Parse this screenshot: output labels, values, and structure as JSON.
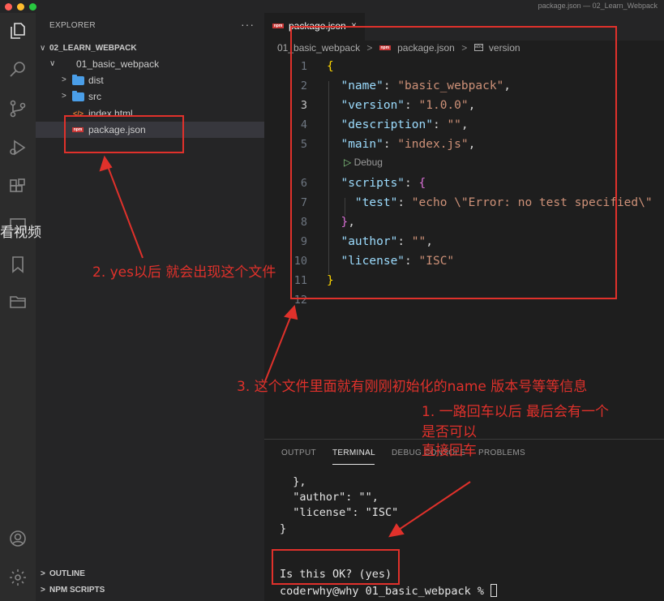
{
  "window": {
    "title": "package.json — 02_Learn_Webpack"
  },
  "activity_bar": {
    "icons": [
      "explorer-icon",
      "search-icon",
      "source-control-icon",
      "run-debug-icon",
      "extensions-icon",
      "remote-icon",
      "bookmark-icon",
      "folder-icon",
      "account-icon",
      "settings-gear-icon"
    ]
  },
  "watermark": "看视频",
  "sidebar": {
    "header": "EXPLORER",
    "more": "···",
    "workspace": "02_LEARN_WEBPACK",
    "tree": [
      {
        "label": "01_basic_webpack",
        "type": "folder",
        "open": true
      },
      {
        "label": "dist",
        "type": "folder",
        "open": false
      },
      {
        "label": "src",
        "type": "folder",
        "open": false
      },
      {
        "label": "index.html",
        "type": "html"
      },
      {
        "label": "package.json",
        "type": "npm",
        "selected": true
      }
    ],
    "sections": [
      "OUTLINE",
      "NPM SCRIPTS"
    ]
  },
  "editor": {
    "tab": {
      "label": "package.json",
      "close": "×",
      "icon_text": "npm"
    },
    "breadcrumb": [
      "01_basic_webpack",
      "package.json",
      "version"
    ],
    "debug_lens": "Debug",
    "lines": [
      {
        "n": "1",
        "tokens": [
          [
            "b1",
            "{"
          ]
        ]
      },
      {
        "n": "2",
        "tokens": [
          [
            "k",
            "\"name\""
          ],
          [
            "p",
            ": "
          ],
          [
            "s",
            "\"basic_webpack\""
          ],
          [
            "p",
            ","
          ]
        ]
      },
      {
        "n": "3",
        "tokens": [
          [
            "k",
            "\"version\""
          ],
          [
            "p",
            ": "
          ],
          [
            "s",
            "\"1.0.0\""
          ],
          [
            "p",
            ","
          ]
        ]
      },
      {
        "n": "4",
        "tokens": [
          [
            "k",
            "\"description\""
          ],
          [
            "p",
            ": "
          ],
          [
            "s",
            "\"\""
          ],
          [
            "p",
            ","
          ]
        ]
      },
      {
        "n": "5",
        "tokens": [
          [
            "k",
            "\"main\""
          ],
          [
            "p",
            ": "
          ],
          [
            "s",
            "\"index.js\""
          ],
          [
            "p",
            ","
          ]
        ]
      },
      {
        "n": "6",
        "tokens": [
          [
            "k",
            "\"scripts\""
          ],
          [
            "p",
            ": "
          ],
          [
            "b2",
            "{"
          ]
        ]
      },
      {
        "n": "7",
        "tokens": [
          [
            "k",
            "\"test\""
          ],
          [
            "p",
            ": "
          ],
          [
            "s",
            "\"echo \\\"Error: no test specified\\\""
          ]
        ]
      },
      {
        "n": "8",
        "tokens": [
          [
            "b2",
            "}"
          ],
          [
            "p",
            ","
          ]
        ]
      },
      {
        "n": "9",
        "tokens": [
          [
            "k",
            "\"author\""
          ],
          [
            "p",
            ": "
          ],
          [
            "s",
            "\"\""
          ],
          [
            "p",
            ","
          ]
        ]
      },
      {
        "n": "10",
        "tokens": [
          [
            "k",
            "\"license\""
          ],
          [
            "p",
            ": "
          ],
          [
            "s",
            "\"ISC\""
          ]
        ]
      },
      {
        "n": "11",
        "tokens": [
          [
            "b1",
            "}"
          ]
        ]
      },
      {
        "n": "12",
        "tokens": []
      }
    ],
    "current_line": "3"
  },
  "panel": {
    "tabs": [
      "OUTPUT",
      "TERMINAL",
      "DEBUG CONSOLE",
      "PROBLEMS"
    ],
    "active_tab": "TERMINAL",
    "terminal_lines": [
      "  },",
      "  \"author\": \"\",",
      "  \"license\": \"ISC\"",
      "}",
      "",
      "Is this OK? (yes)",
      "coderwhy@why 01_basic_webpack % "
    ]
  },
  "annotations": {
    "note2": "2. yes以后 就会出现这个文件",
    "note3": "3. 这个文件里面就有刚刚初始化的name 版本号等等信息",
    "note1_line1": "1. 一路回车以后 最后会有一个",
    "note1_line2": "是否可以",
    "note1_line3": "直接回车",
    "color": "#e0312b"
  },
  "colors": {
    "background": "#1e1e1e",
    "sidebar": "#252526",
    "activity": "#2c2c2c",
    "key": "#9cdcfe",
    "string": "#ce9178"
  }
}
